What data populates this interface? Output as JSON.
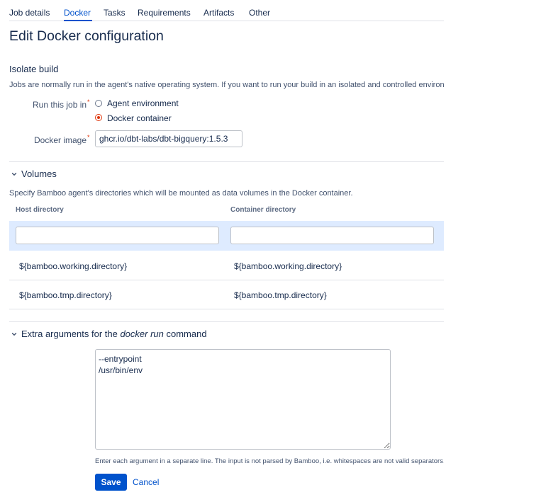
{
  "tabs": [
    {
      "label": "Job details",
      "active": false
    },
    {
      "label": "Docker",
      "active": true
    },
    {
      "label": "Tasks",
      "active": false
    },
    {
      "label": "Requirements",
      "active": false
    },
    {
      "label": "Artifacts",
      "active": false
    },
    {
      "label": "Other",
      "active": false
    }
  ],
  "page_title": "Edit Docker configuration",
  "isolate": {
    "heading": "Isolate build",
    "description": "Jobs are normally run in the agent's native operating system. If you want to run your build in an isolated and controlled environment, you can do it with Docker.",
    "run_label": "Run this job in",
    "required_marker": "*",
    "options": [
      {
        "label": "Agent environment",
        "checked": false
      },
      {
        "label": "Docker container",
        "checked": true
      }
    ],
    "image_label": "Docker image",
    "image_value": "ghcr.io/dbt-labs/dbt-bigquery:1.5.3"
  },
  "volumes": {
    "heading": "Volumes",
    "description": "Specify Bamboo agent's directories which will be mounted as data volumes in the Docker container.",
    "columns": [
      "Host directory",
      "Container directory"
    ],
    "new_row": {
      "host": "",
      "container": ""
    },
    "rows": [
      {
        "host": "${bamboo.working.directory}",
        "container": "${bamboo.working.directory}"
      },
      {
        "host": "${bamboo.tmp.directory}",
        "container": "${bamboo.tmp.directory}"
      }
    ]
  },
  "extra_args": {
    "heading_prefix": "Extra arguments for the ",
    "heading_em": "docker run",
    "heading_suffix": " command",
    "value": "--entrypoint\n/usr/bin/env",
    "help": "Enter each argument in a separate line. The input is not parsed by Bamboo, i.e. whitespaces are not valid separators."
  },
  "actions": {
    "save": "Save",
    "cancel": "Cancel"
  },
  "colors": {
    "accent": "#0052cc",
    "required": "#de350b",
    "highlight_row": "#deebff"
  }
}
